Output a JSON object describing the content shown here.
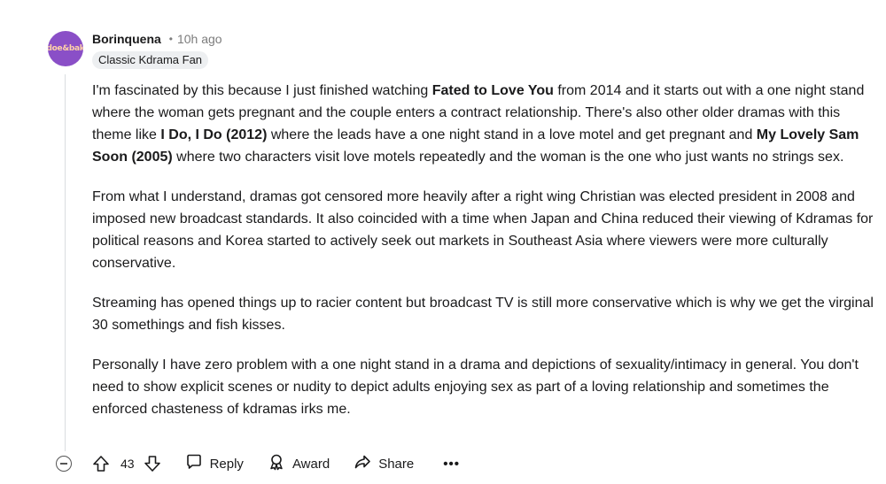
{
  "comment": {
    "avatar_text": "doe&bak",
    "username": "Borinquena",
    "separator": "•",
    "time": "10h ago",
    "flair": "Classic Kdrama Fan",
    "paragraphs": {
      "p1": {
        "t1": "I'm fascinated by this because I just finished watching ",
        "b1": "Fated to Love You",
        "t2": " from 2014 and it starts out with a one night stand where the woman gets pregnant and the couple enters a contract relationship. There's also other older dramas with this theme like ",
        "b2": "I Do, I Do (2012)",
        "t3": " where the leads have a one night stand in a love motel and get pregnant and ",
        "b3": "My Lovely Sam Soon (2005)",
        "t4": " where two characters visit love motels repeatedly and the woman is the one who just wants no strings sex."
      },
      "p2": "From what I understand, dramas got censored more heavily after a right wing Christian was elected president in 2008 and imposed new broadcast standards. It also coincided with a time when Japan and China reduced their viewing of Kdramas for political reasons and Korea started to actively seek out markets in Southeast Asia where viewers were more culturally conservative.",
      "p3": "Streaming has opened things up to racier content but broadcast TV is still more conservative which is why we get the virginal 30 somethings and fish kisses.",
      "p4": "Personally I have zero problem with a one night stand in a drama and depictions of sexuality/intimacy in general. You don't need to show explicit scenes or nudity to depict adults enjoying sex as part of a loving relationship and sometimes the enforced chasteness of kdramas irks me."
    }
  },
  "actions": {
    "score": "43",
    "reply_label": "Reply",
    "award_label": "Award",
    "share_label": "Share",
    "more_label": "•••"
  },
  "icons": {
    "collapse": "collapse-icon",
    "upvote": "upvote-icon",
    "downvote": "downvote-icon",
    "reply": "speech-bubble-icon",
    "award": "award-icon",
    "share": "share-arrow-icon"
  }
}
